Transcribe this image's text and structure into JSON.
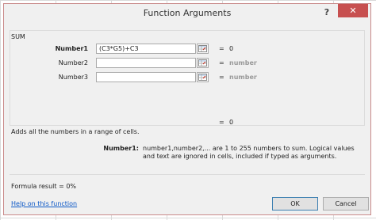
{
  "dialog": {
    "title": "Function Arguments",
    "help_glyph": "?",
    "close_glyph": "✕",
    "function_name": "SUM",
    "args": [
      {
        "label": "Number1",
        "value": "(C3*G5)+C3",
        "result": "0"
      },
      {
        "label": "Number2",
        "value": "",
        "result": "number"
      },
      {
        "label": "Number3",
        "value": "",
        "result": "number"
      }
    ],
    "equals": "=",
    "total_result": "0",
    "description": "Adds all the numbers in a range of cells.",
    "arg_help_label": "Number1:",
    "arg_help_text": "number1,number2,... are 1 to 255 numbers to sum. Logical values and text are ignored in cells, included if typed as arguments.",
    "formula_result_label": "Formula result =",
    "formula_result_value": "0%",
    "help_link": "Help on this function",
    "ok_label": "OK",
    "cancel_label": "Cancel"
  },
  "colors": {
    "close_button": "#c75050",
    "link": "#0b57c6",
    "dialog_border": "#c98a8a"
  }
}
